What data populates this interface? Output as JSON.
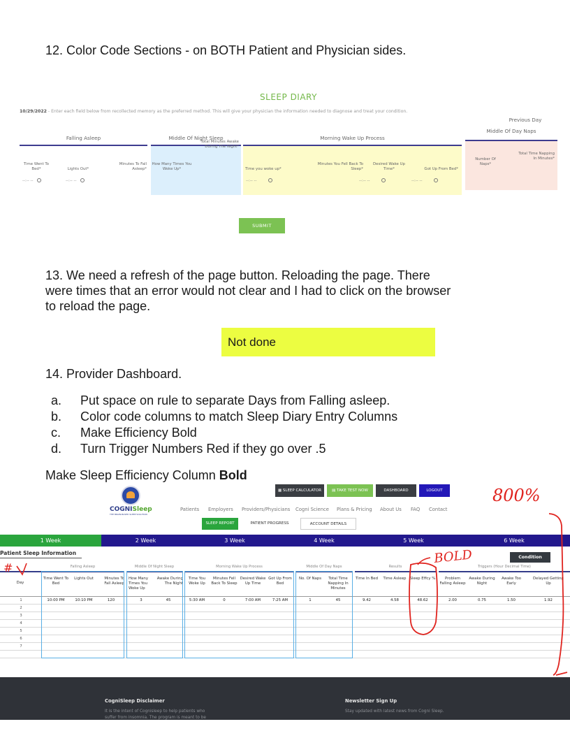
{
  "doc": {
    "item12": "12. Color Code Sections - on BOTH Patient and Physician sides.",
    "item13_l1": "13. We need a refresh of the page button. Reloading the page. There",
    "item13_l2": "were times that an error would not clear and I had to click on the browser",
    "item13_l3": "to reload the page.",
    "not_done": "Not done",
    "item14": "14. Provider Dashboard.",
    "sub_items": [
      {
        "marker": "a.",
        "text": "Put space on rule to separate Days from Falling asleep."
      },
      {
        "marker": "b.",
        "text": "Color code columns to match Sleep Diary Entry Columns"
      },
      {
        "marker": "c.",
        "text": "Make Efficiency Bold"
      },
      {
        "marker": "d.",
        "text": "Turn Trigger Numbers Red if they go over .5"
      }
    ],
    "make_bold_prefix": "Make Sleep Efficiency Column ",
    "make_bold_bold": "Bold"
  },
  "diary": {
    "title": "SLEEP DIARY",
    "date": "10/29/2022",
    "instruction": " - Enter each field below from recollected memory as the preferred method. This will give your physician the information needed to diagnose and treat your condition.",
    "groups": {
      "falling": "Falling Asleep",
      "middle": "Middle Of Night Sleep",
      "morning": "Morning Wake Up Process",
      "naps_l1": "Previous Day",
      "naps_l2": "Middle Of Day Naps"
    },
    "fields": {
      "time_went_to_bed": "Time Went To Bed*",
      "lights_out": "Lights Out*",
      "minutes_to_fall_asleep": "Minutes To Fall Asleep*",
      "how_many_times": "How Many Times You Woke Up*",
      "total_minutes_awake": "Total Minutes Awake During The Night*",
      "time_you_woke_up": "Time you woke up*",
      "minutes_fell_back": "Minutes You Fell Back To Sleep*",
      "desired_wake_up": "Desired Wake Up Time*",
      "got_up_from_bed": "Got Up From Bed*",
      "number_of_naps": "Number Of Naps*",
      "total_time_napping": "Total Time Napping In Minutes*"
    },
    "time_placeholder": "--:-- --",
    "submit": "SUBMIT",
    "colors": {
      "blue_group": "#dceffc",
      "yellow_group": "#fdfbc9",
      "pink_group": "#fbe6df",
      "submit": "#7cc253",
      "title": "#74b84a"
    }
  },
  "dash": {
    "logo": {
      "brand_a": "COGNI",
      "brand_b": "Sleep",
      "tagline": "THE BRAIN-BASED SLEEP SOLUTION"
    },
    "top_buttons": {
      "calculator": "SLEEP CALCULATOR",
      "test": "TAKE TEST NOW",
      "dashboard": "DASHBOARD",
      "logout": "LOGOUT"
    },
    "nav": [
      "Patients",
      "Employers",
      "Providers/Physicians",
      "Cogni Science",
      "Plans & Pricing",
      "About Us",
      "FAQ",
      "Contact"
    ],
    "tabs": {
      "report": "SLEEP REPORT",
      "progress": "PATIENT PROGRESS",
      "account": "ACCOUNT DETAILS"
    },
    "weeks": [
      "1 Week",
      "2 Week",
      "3 Week",
      "4 Week",
      "5 Week",
      "6 Week"
    ],
    "section_title": "Patient Sleep Information",
    "legend_btn": "Condition Legend",
    "groups": {
      "falling": "Falling Asleep",
      "middle": "Middle Of Night Sleep",
      "morning": "Morning Wake Up Process",
      "naps": "Middle Of Day Naps",
      "results": "Results",
      "triggers": "Triggers (Hour Decimal Time)"
    },
    "columns": {
      "day": "Day",
      "time_went_to_bed": "Time Went To Bed",
      "lights_out": "Lights Out",
      "minutes_to_fall_asleep": "Minutes To Fall Asleep",
      "how_many_times": "How Many Times You Woke Up",
      "awake_during_night": "Awake During The Night",
      "time_you_woke_up": "Time You Woke Up",
      "minutes_fell_back": "Minutes Fell Back To Sleep",
      "desired_wake_up": "Desired Wake Up Time",
      "got_up_from_bed": "Got Up From Bed",
      "no_of_naps": "No. Of Naps",
      "total_time_napping": "Total Time Napping In Minutes",
      "time_in_bed": "Time In Bed",
      "time_asleep": "Time Asleep",
      "sleep_effcy": "Sleep Effcy %",
      "problem_falling": "Problem Falling Asleep",
      "awake_during_night_t": "Awake During Night",
      "awake_too_early": "Awake Too Early",
      "delayed_getting_up": "Delayed Getting Up"
    },
    "row1": {
      "day": "1",
      "time_went_to_bed": "10:00 PM",
      "lights_out": "10:10 PM",
      "minutes_to_fall_asleep": "120",
      "how_many_times": "3",
      "awake_during_night": "45",
      "time_you_woke_up": "5:30 AM",
      "minutes_fell_back": "0",
      "desired_wake_up": "7:00 AM",
      "got_up_from_bed": "7:25 AM",
      "no_of_naps": "1",
      "total_time_napping": "45",
      "time_in_bed": "9.42",
      "time_asleep": "4.58",
      "sleep_effcy": "48.62",
      "problem_falling": "2.00",
      "awake_during_night_t": "0.75",
      "awake_too_early": "1.50",
      "delayed_getting_up": "1.92"
    },
    "days": [
      "2",
      "3",
      "4",
      "5",
      "6",
      "7"
    ],
    "footer": {
      "disclaimer_title": "CogniSleep Disclaimer",
      "disclaimer_text_1": "It is the intent of Cognisleep to help patients who",
      "disclaimer_text_2": "suffer from insomnia. The program is meant to be",
      "newsletter_title": "Newsletter Sign Up",
      "newsletter_text": "Stay updated with latest news from Cogni Sleep."
    },
    "colors": {
      "week_active": "#2aa53d",
      "week": "#22188d",
      "tab_active": "#2aa53d",
      "annotation": "#e0241f",
      "bluebox": "#58aee5"
    }
  },
  "annotations": {
    "zoom": "800%",
    "bold": "BOLD",
    "hash": "#"
  }
}
